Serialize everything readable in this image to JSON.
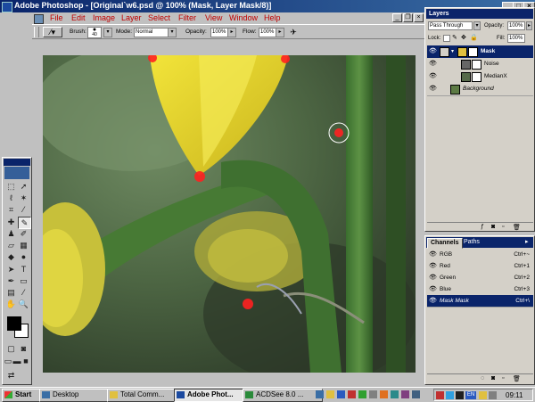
{
  "window": {
    "title": "Adobe Photoshop - [Original`w6.psd @ 100% (Mask, Layer Mask/8)]",
    "controls": {
      "minimize": "_",
      "maximize": "□",
      "close": "×"
    }
  },
  "menu": {
    "items": [
      "File",
      "Edit",
      "Image",
      "Layer",
      "Select",
      "Filter",
      "View",
      "Window",
      "Help"
    ]
  },
  "options": {
    "brush_label": "Brush:",
    "brush_size": "40",
    "mode_label": "Mode:",
    "mode_value": "Normal",
    "opacity_label": "Opacity:",
    "opacity_value": "100%",
    "flow_label": "Flow:",
    "flow_value": "100%"
  },
  "layers_panel": {
    "title": "Layers",
    "blend_mode": "Pass Through",
    "opacity_label": "Opacity:",
    "opacity_value": "100%",
    "lock_label": "Lock:",
    "fill_label": "Fill:",
    "fill_value": "100%",
    "layers": [
      {
        "name": "Mask",
        "selected": true,
        "type": "group"
      },
      {
        "name": "Noise",
        "selected": false,
        "type": "layer"
      },
      {
        "name": "MedianX",
        "selected": false,
        "type": "layer"
      },
      {
        "name": "Background",
        "selected": false,
        "type": "background"
      }
    ]
  },
  "channels_panel": {
    "tabs": [
      "Channels",
      "Paths"
    ],
    "channels": [
      {
        "name": "RGB",
        "shortcut": "Ctrl+~",
        "selected": false
      },
      {
        "name": "Red",
        "shortcut": "Ctrl+1",
        "selected": false
      },
      {
        "name": "Green",
        "shortcut": "Ctrl+2",
        "selected": false
      },
      {
        "name": "Blue",
        "shortcut": "Ctrl+3",
        "selected": false
      },
      {
        "name": "Mask Mask",
        "shortcut": "Ctrl+\\",
        "selected": true
      }
    ]
  },
  "taskbar": {
    "start_label": "Start",
    "buttons": [
      "Desktop",
      "Total Comm...",
      "Adobe Phot...",
      "ACDSee 8.0 ..."
    ],
    "active_index": 2,
    "clock": "09:11"
  },
  "colors": {
    "title_bar": "#0a246a",
    "menu_text": "#c00000",
    "selection": "#0a246a",
    "face": "#c0c0c0"
  }
}
